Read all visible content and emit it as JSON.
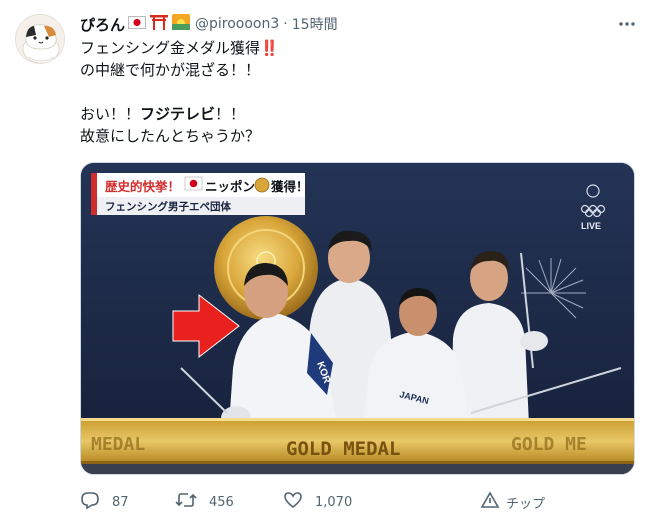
{
  "tweet": {
    "display_name": "ぴろん",
    "handle": "@piroooon3",
    "separator": "·",
    "time": "15時間",
    "lines": [
      {
        "pre": "フェンシング金メダル獲得",
        "excl": "‼️"
      },
      {
        "text": "の中継で何かが混ざる！！"
      },
      {
        "blank": true
      },
      {
        "pre": "おい！！",
        "bold": "フジテレビ",
        "post": "！！"
      },
      {
        "text": "故意にしたんとちゃうか？"
      }
    ]
  },
  "media": {
    "headline_part1": "歴史的快挙！",
    "headline_part2": "ニッポン",
    "headline_part3": "獲得！",
    "subtitle": "フェンシング男子エペ団体",
    "live_label": "LIVE",
    "banner_text": "GOLD MEDAL",
    "banner_left": "MEDAL",
    "banner_right": "GOLD ME",
    "jersey_text": "KOR",
    "jersey2_text": "JAPAN",
    "colors": {
      "background": "#1e2b4a",
      "gold": "#d4a535",
      "arrow": "#e8201e",
      "headline_red": "#d22d2d"
    }
  },
  "actions": {
    "reply": "87",
    "retweet": "456",
    "like": "1,070",
    "tip": "チップ"
  },
  "icons": [
    "more-icon",
    "reply-icon",
    "retweet-icon",
    "like-icon",
    "tip-icon"
  ]
}
